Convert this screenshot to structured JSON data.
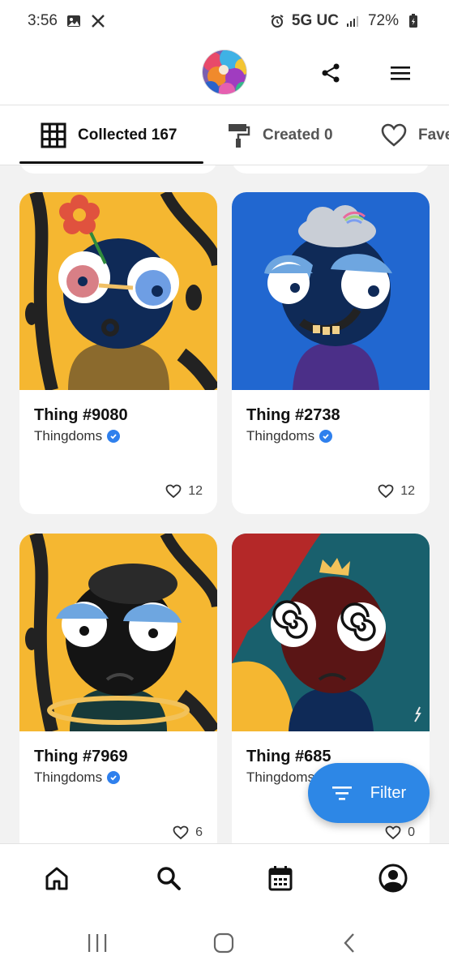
{
  "status_bar": {
    "time": "3:56",
    "network": "5G UC",
    "battery": "72%",
    "icons": [
      "image-icon",
      "x-logo-icon",
      "alarm-icon",
      "signal-icon",
      "battery-icon"
    ]
  },
  "header": {
    "icons": [
      "share-icon",
      "menu-icon"
    ]
  },
  "tabs": [
    {
      "label": "Collected 167",
      "icon": "grid-icon",
      "active": true
    },
    {
      "label": "Created 0",
      "icon": "paint-roller-icon",
      "active": false
    },
    {
      "label": "Fave",
      "icon": "heart-icon",
      "active": false
    }
  ],
  "cards": [
    {
      "title": "Thing #9080",
      "collection": "Thingdoms",
      "likes": "12"
    },
    {
      "title": "Thing #2738",
      "collection": "Thingdoms",
      "likes": "12"
    },
    {
      "title": "Thing #7969",
      "collection": "Thingdoms",
      "likes": "6"
    },
    {
      "title": "Thing #685",
      "collection": "Thingdoms",
      "likes": "0"
    }
  ],
  "filter_button": {
    "label": "Filter"
  },
  "bottom_nav": [
    "home-icon",
    "search-icon",
    "calendar-icon",
    "profile-icon"
  ],
  "colors": {
    "accent": "#2d87e6",
    "verified": "#2f80ed",
    "card_bg": "#ffffff",
    "page_bg": "#f2f2f2"
  }
}
